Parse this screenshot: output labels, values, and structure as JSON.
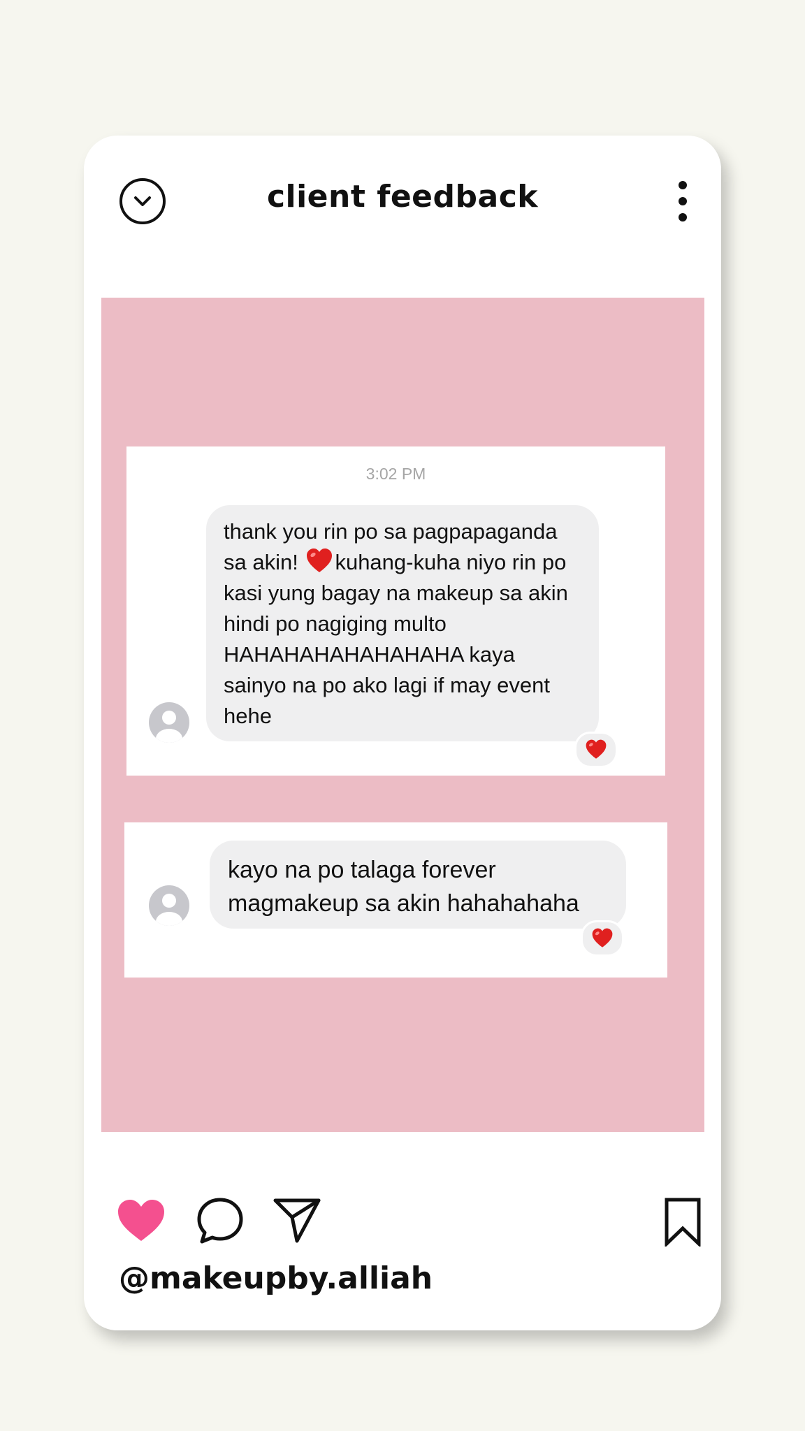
{
  "header": {
    "title": "client feedback",
    "left_icon": "chevron-down-circle-icon",
    "right_icon": "more-vertical-icon"
  },
  "post": {
    "background_color": "#ecbcc5",
    "messages": [
      {
        "timestamp": "3:02 PM",
        "text_before_emoji": "thank you rin po sa pagpapaganda\nsa akin! ",
        "inline_emoji": "red-heart-emoji",
        "text_after_emoji": "kuhang-kuha niyo rin po\nkasi yung bagay na makeup sa akin\nhindi po nagiging multo\nHAHAHAHAHAHAHAHA kaya\nsainyo na po ako lagi if may event\nhehe",
        "reaction": "red-heart-emoji"
      },
      {
        "text": "kayo na po talaga forever\nmagmakeup sa akin hahahahaha",
        "reaction": "red-heart-emoji"
      }
    ]
  },
  "actions": {
    "like": "heart-icon",
    "comment": "comment-bubble-icon",
    "share": "send-icon",
    "save": "bookmark-icon",
    "like_color": "#f4508f"
  },
  "handle": "@makeupby.alliah"
}
